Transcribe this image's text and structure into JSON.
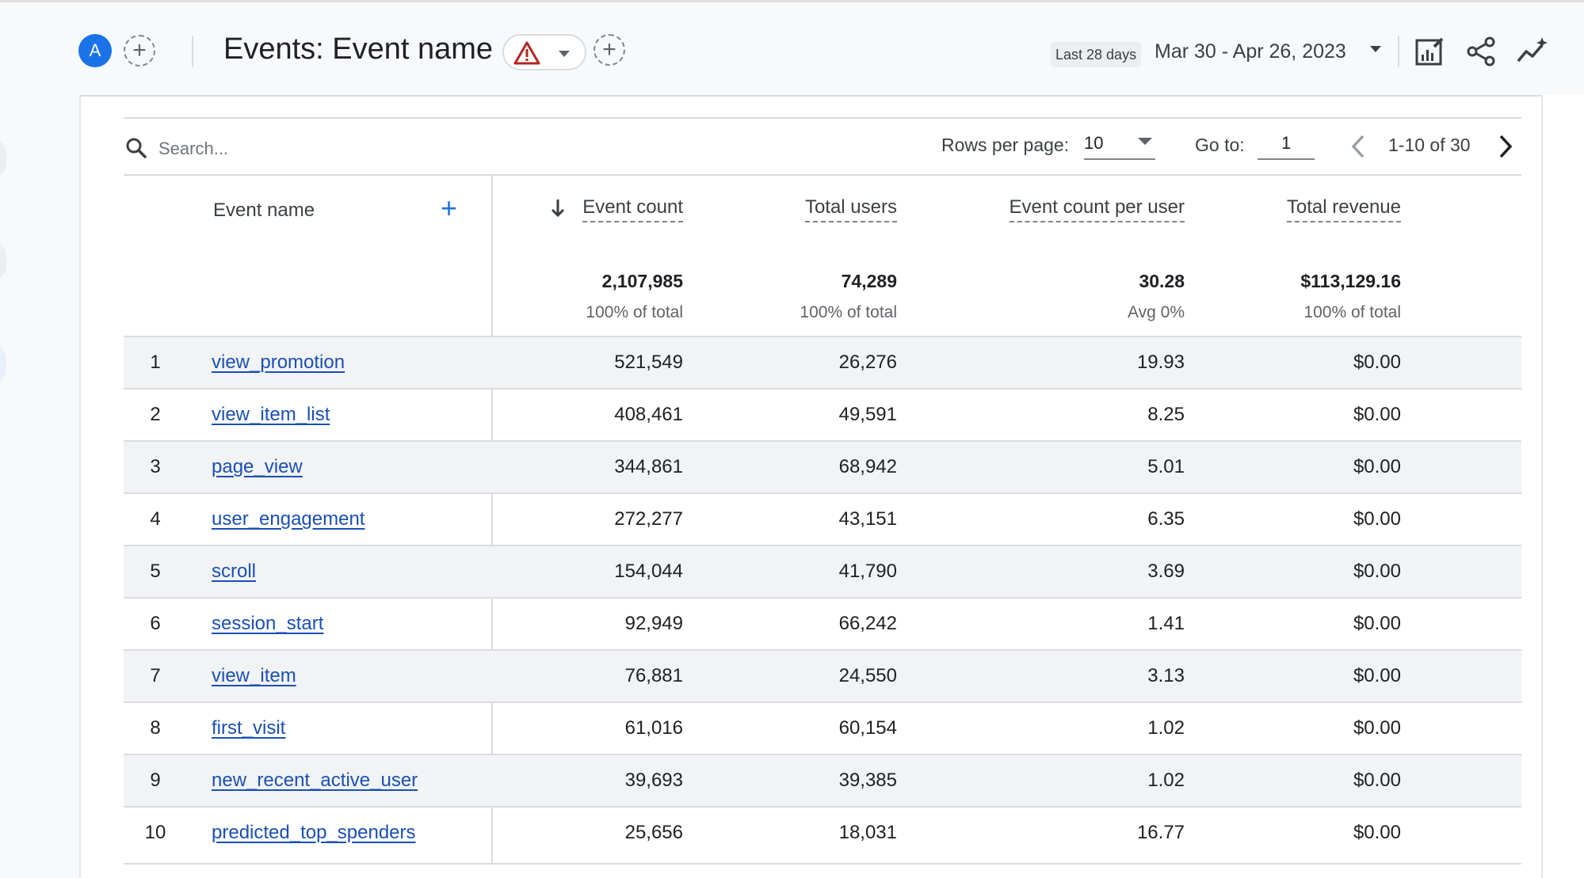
{
  "header": {
    "avatar_letter": "A",
    "title": "Events: Event name",
    "date_label": "Last 28 days",
    "date_range": "Mar 30 - Apr 26, 2023",
    "icons": [
      "add-comparison-icon",
      "warning-icon",
      "chevron-down-icon",
      "add-filter-icon",
      "customize-report-icon",
      "share-icon",
      "insights-icon"
    ]
  },
  "toolbar": {
    "search_placeholder": "Search...",
    "rows_per_page_label": "Rows per page:",
    "rows_per_page_value": "10",
    "go_to_label": "Go to:",
    "go_to_value": "1",
    "pagination_text": "1-10 of 30"
  },
  "table": {
    "dimension_header": "Event name",
    "columns": [
      "Event count",
      "Total users",
      "Event count per user",
      "Total revenue"
    ],
    "sorted_column": "Event count",
    "sort_direction": "descending",
    "totals": [
      {
        "value": "2,107,985",
        "sub": "100% of total"
      },
      {
        "value": "74,289",
        "sub": "100% of total"
      },
      {
        "value": "30.28",
        "sub": "Avg 0%"
      },
      {
        "value": "$113,129.16",
        "sub": "100% of total"
      }
    ],
    "rows": [
      {
        "idx": "1",
        "name": "view_promotion",
        "event_count": "521,549",
        "total_users": "26,276",
        "per_user": "19.93",
        "revenue": "$0.00"
      },
      {
        "idx": "2",
        "name": "view_item_list",
        "event_count": "408,461",
        "total_users": "49,591",
        "per_user": "8.25",
        "revenue": "$0.00"
      },
      {
        "idx": "3",
        "name": "page_view",
        "event_count": "344,861",
        "total_users": "68,942",
        "per_user": "5.01",
        "revenue": "$0.00"
      },
      {
        "idx": "4",
        "name": "user_engagement",
        "event_count": "272,277",
        "total_users": "43,151",
        "per_user": "6.35",
        "revenue": "$0.00"
      },
      {
        "idx": "5",
        "name": "scroll",
        "event_count": "154,044",
        "total_users": "41,790",
        "per_user": "3.69",
        "revenue": "$0.00"
      },
      {
        "idx": "6",
        "name": "session_start",
        "event_count": "92,949",
        "total_users": "66,242",
        "per_user": "1.41",
        "revenue": "$0.00"
      },
      {
        "idx": "7",
        "name": "view_item",
        "event_count": "76,881",
        "total_users": "24,550",
        "per_user": "3.13",
        "revenue": "$0.00"
      },
      {
        "idx": "8",
        "name": "first_visit",
        "event_count": "61,016",
        "total_users": "60,154",
        "per_user": "1.02",
        "revenue": "$0.00"
      },
      {
        "idx": "9",
        "name": "new_recent_active_user",
        "event_count": "39,693",
        "total_users": "39,385",
        "per_user": "1.02",
        "revenue": "$0.00"
      },
      {
        "idx": "10",
        "name": "predicted_top_spenders",
        "event_count": "25,656",
        "total_users": "18,031",
        "per_user": "16.77",
        "revenue": "$0.00"
      }
    ]
  },
  "colors": {
    "accent": "#1a73e8",
    "link": "#1a4fb5",
    "warning": "#b3261e",
    "row_shade": "#f1f3f4"
  }
}
